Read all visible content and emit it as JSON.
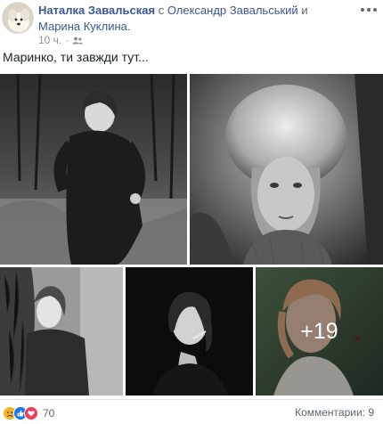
{
  "post": {
    "author": "Наталка Завальская",
    "conjunction": "с",
    "tagged_1": "Олександр Завальський",
    "conjunction_2": "и",
    "tagged_2": "Марина Куклина",
    "period": ".",
    "time": "10 ч.",
    "separator": "·",
    "privacy_icon": "friends-icon",
    "text": "Маринко, ти завжди тут..."
  },
  "photos": {
    "items": [
      {
        "alt": "photo-1",
        "tone": "outdoor-bw"
      },
      {
        "alt": "photo-2",
        "tone": "fur-hat-bw"
      },
      {
        "alt": "photo-3",
        "tone": "tree-bw"
      },
      {
        "alt": "photo-4",
        "tone": "dark-portrait-bw"
      },
      {
        "alt": "photo-5",
        "tone": "color-portrait"
      }
    ],
    "more_label": "+19"
  },
  "footer": {
    "reactions": [
      "sad",
      "like",
      "love"
    ],
    "reaction_count": "70",
    "comments": "Комментарии: 9"
  },
  "colors": {
    "link": "#385898",
    "like": "#1877f2",
    "love": "#f33e58",
    "sad": "#f7b125"
  }
}
